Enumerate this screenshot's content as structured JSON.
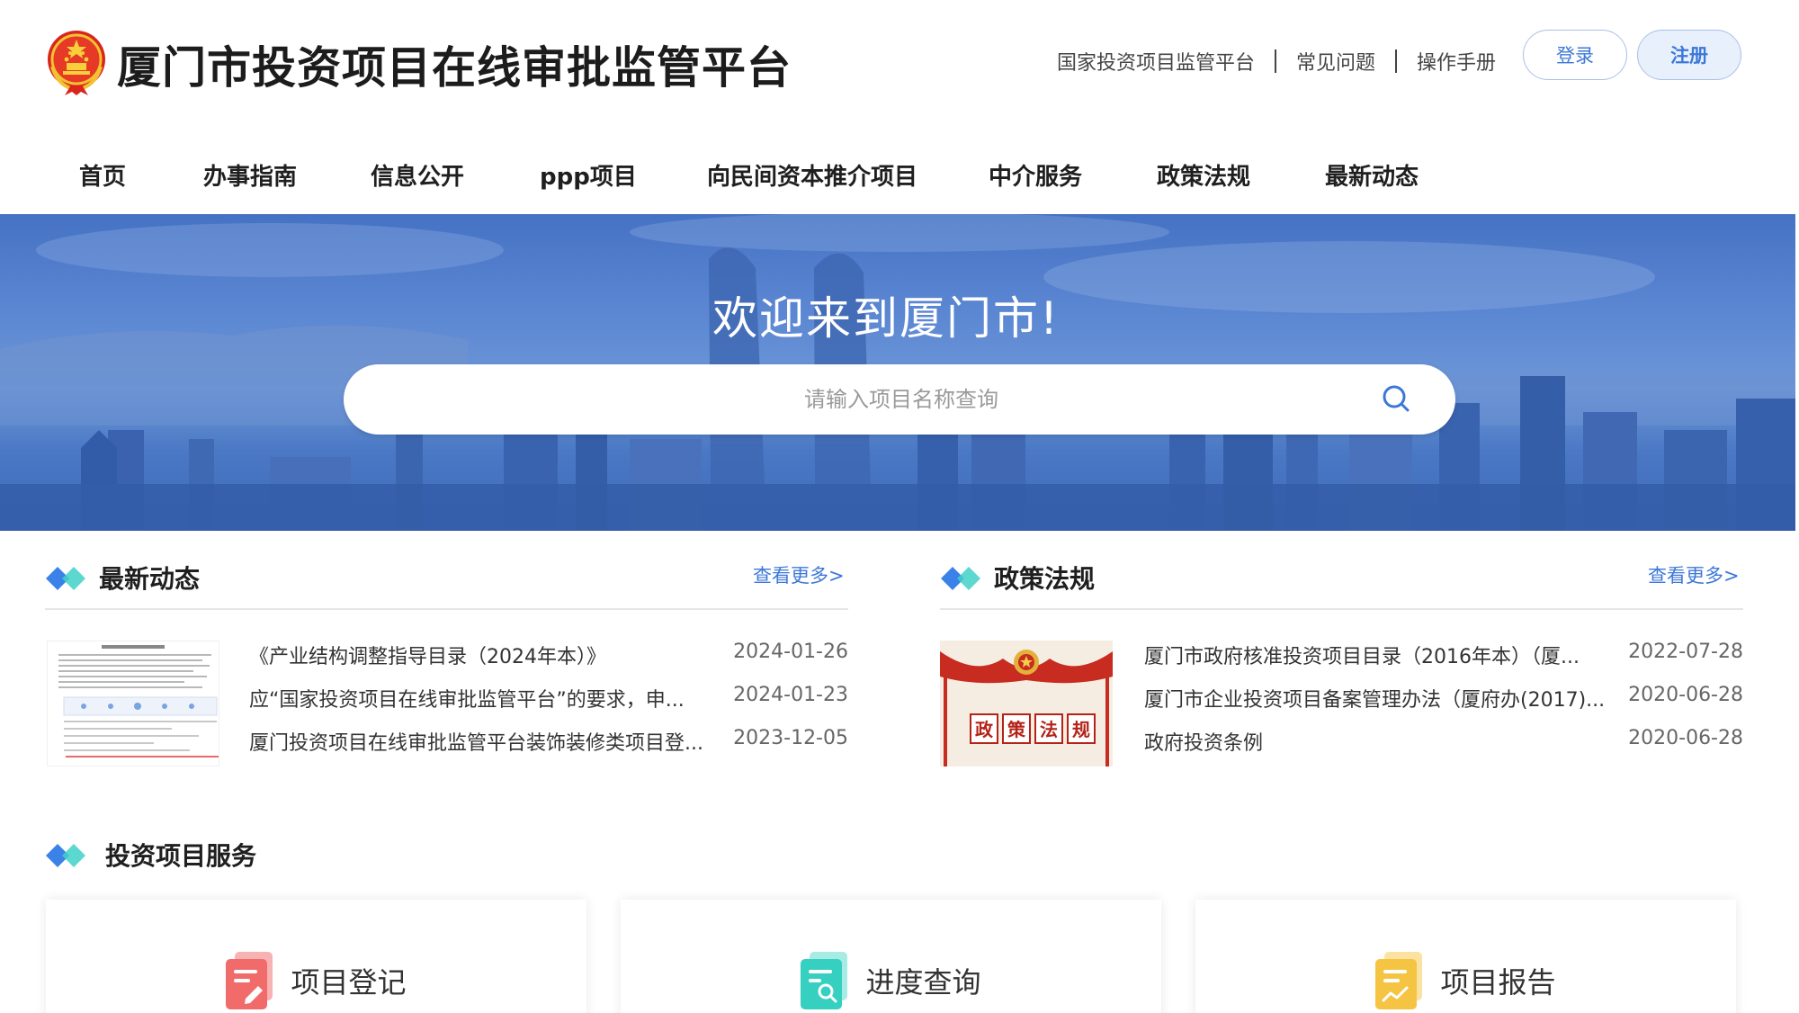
{
  "header": {
    "title": "厦门市投资项目在线审批监管平台",
    "links": [
      "国家投资项目监管平台",
      "常见问题",
      "操作手册"
    ],
    "login_label": "登录",
    "register_label": "注册"
  },
  "nav": {
    "items": [
      "首页",
      "办事指南",
      "信息公开",
      "ppp项目",
      "向民间资本推介项目",
      "中介服务",
      "政策法规",
      "最新动态"
    ]
  },
  "banner": {
    "welcome": "欢迎来到厦门市!",
    "search_placeholder": "请输入项目名称查询"
  },
  "news": {
    "title": "最新动态",
    "more": "查看更多>",
    "items": [
      {
        "title": "《产业结构调整指导目录（2024年本）》",
        "date": "2024-01-26"
      },
      {
        "title": "应“国家投资项目在线审批监管平台”的要求，申...",
        "date": "2024-01-23"
      },
      {
        "title": "厦门投资项目在线审批监管平台装饰装修类项目登...",
        "date": "2023-12-05"
      }
    ]
  },
  "policy": {
    "title": "政策法规",
    "more": "查看更多>",
    "thumb_text": [
      "政",
      "策",
      "法",
      "规"
    ],
    "items": [
      {
        "title": "厦门市政府核准投资项目目录（2016年本）（厦...",
        "date": "2022-07-28"
      },
      {
        "title": "厦门市企业投资项目备案管理办法（厦府办(2017)...",
        "date": "2020-06-28"
      },
      {
        "title": "政府投资条例",
        "date": "2020-06-28"
      }
    ]
  },
  "services": {
    "title": "投资项目服务",
    "cards": [
      {
        "label": "项目登记",
        "icon": "edit-document-icon",
        "color": "#f26b6b"
      },
      {
        "label": "进度查询",
        "icon": "search-document-icon",
        "color": "#35d0c0"
      },
      {
        "label": "项目报告",
        "icon": "report-document-icon",
        "color": "#f6c443"
      }
    ]
  },
  "colors": {
    "accent": "#3d78d8",
    "diamond_blue": "#3b82e8",
    "diamond_teal": "#3fd1c9"
  }
}
